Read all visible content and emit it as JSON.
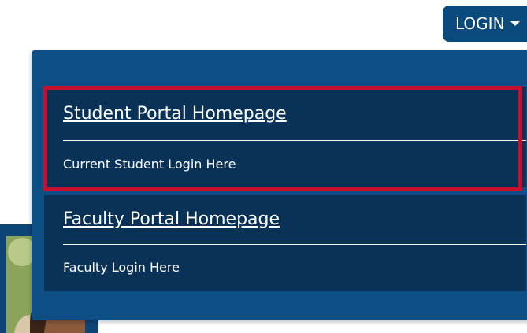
{
  "header": {
    "login_label": "LOGIN"
  },
  "dropdown": {
    "items": [
      {
        "title": "Student Portal Homepage",
        "sublink": "Current Student Login Here"
      },
      {
        "title": "Faculty Portal Homepage",
        "sublink": "Faculty Login Here"
      }
    ]
  },
  "colors": {
    "primary_blue": "#0b4a7c",
    "menu_bg": "#0d4e84",
    "item_bg": "#093256",
    "highlight_red": "#c8102e"
  },
  "icons": {
    "login_caret": "chevron-down-icon"
  }
}
